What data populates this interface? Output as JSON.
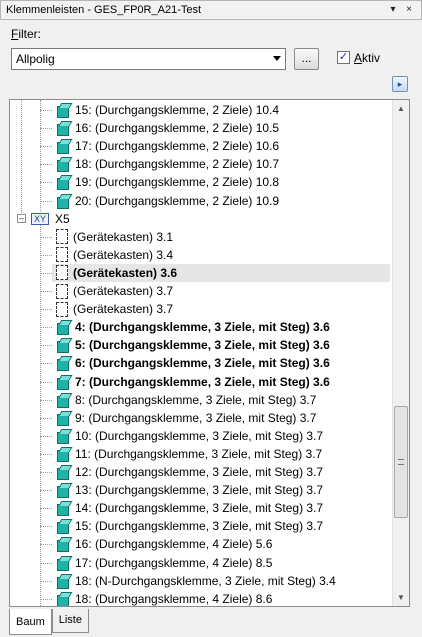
{
  "window": {
    "title": "Klemmenleisten - GES_FP0R_A21-Test",
    "pin_icon": "▾",
    "close_icon": "×"
  },
  "filter": {
    "label_prefix": "F",
    "label_rest": "ilter:",
    "selected": "Allpolig",
    "dots_label": "...",
    "aktiv_checked": true,
    "aktiv_label_prefix": "A",
    "aktiv_label_rest": "ktiv",
    "check_mark": "✓"
  },
  "nav_button": "▸",
  "tree": {
    "group_label": "X5",
    "group_badge": "XY",
    "expander": "–",
    "items_before": [
      {
        "label": "15: (Durchgangsklemme, 2 Ziele) 10.4",
        "bold": false,
        "icon": "clamp"
      },
      {
        "label": "16: (Durchgangsklemme, 2 Ziele) 10.5",
        "bold": false,
        "icon": "clamp"
      },
      {
        "label": "17: (Durchgangsklemme, 2 Ziele) 10.6",
        "bold": false,
        "icon": "clamp"
      },
      {
        "label": "18: (Durchgangsklemme, 2 Ziele) 10.7",
        "bold": false,
        "icon": "clamp"
      },
      {
        "label": "19: (Durchgangsklemme, 2 Ziele) 10.8",
        "bold": false,
        "icon": "clamp"
      },
      {
        "label": "20: (Durchgangsklemme, 2 Ziele) 10.9",
        "bold": false,
        "icon": "clamp"
      }
    ],
    "items_after": [
      {
        "label": "(Gerätekasten) 3.1",
        "bold": false,
        "icon": "box"
      },
      {
        "label": "(Gerätekasten) 3.4",
        "bold": false,
        "icon": "box"
      },
      {
        "label": "(Gerätekasten) 3.6",
        "bold": true,
        "icon": "box",
        "selected": true
      },
      {
        "label": "(Gerätekasten) 3.7",
        "bold": false,
        "icon": "box"
      },
      {
        "label": "(Gerätekasten) 3.7",
        "bold": false,
        "icon": "box"
      },
      {
        "label": "4: (Durchgangsklemme, 3 Ziele, mit Steg) 3.6",
        "bold": true,
        "icon": "clamp"
      },
      {
        "label": "5: (Durchgangsklemme, 3 Ziele, mit Steg) 3.6",
        "bold": true,
        "icon": "clamp"
      },
      {
        "label": "6: (Durchgangsklemme, 3 Ziele, mit Steg) 3.6",
        "bold": true,
        "icon": "clamp"
      },
      {
        "label": "7: (Durchgangsklemme, 3 Ziele, mit Steg) 3.6",
        "bold": true,
        "icon": "clamp"
      },
      {
        "label": "8: (Durchgangsklemme, 3 Ziele, mit Steg) 3.7",
        "bold": false,
        "icon": "clamp"
      },
      {
        "label": "9: (Durchgangsklemme, 3 Ziele, mit Steg) 3.7",
        "bold": false,
        "icon": "clamp"
      },
      {
        "label": "10: (Durchgangsklemme, 3 Ziele, mit Steg) 3.7",
        "bold": false,
        "icon": "clamp"
      },
      {
        "label": "11: (Durchgangsklemme, 3 Ziele, mit Steg) 3.7",
        "bold": false,
        "icon": "clamp"
      },
      {
        "label": "12: (Durchgangsklemme, 3 Ziele, mit Steg) 3.7",
        "bold": false,
        "icon": "clamp"
      },
      {
        "label": "13: (Durchgangsklemme, 3 Ziele, mit Steg) 3.7",
        "bold": false,
        "icon": "clamp"
      },
      {
        "label": "14: (Durchgangsklemme, 3 Ziele, mit Steg) 3.7",
        "bold": false,
        "icon": "clamp"
      },
      {
        "label": "15: (Durchgangsklemme, 3 Ziele, mit Steg) 3.7",
        "bold": false,
        "icon": "clamp"
      },
      {
        "label": "16: (Durchgangsklemme, 4 Ziele) 5.6",
        "bold": false,
        "icon": "clamp"
      },
      {
        "label": "17: (Durchgangsklemme, 4 Ziele) 8.5",
        "bold": false,
        "icon": "clamp"
      },
      {
        "label": "18: (N-Durchgangsklemme, 3 Ziele, mit Steg) 3.4",
        "bold": false,
        "icon": "clamp"
      },
      {
        "label": "18: (Durchgangsklemme, 4 Ziele) 8.6",
        "bold": false,
        "icon": "clamp"
      }
    ]
  },
  "scroll": {
    "up": "▲",
    "down": "▼"
  },
  "tabs": [
    {
      "label": "Baum",
      "active": true
    },
    {
      "label": "Liste",
      "active": false
    }
  ]
}
